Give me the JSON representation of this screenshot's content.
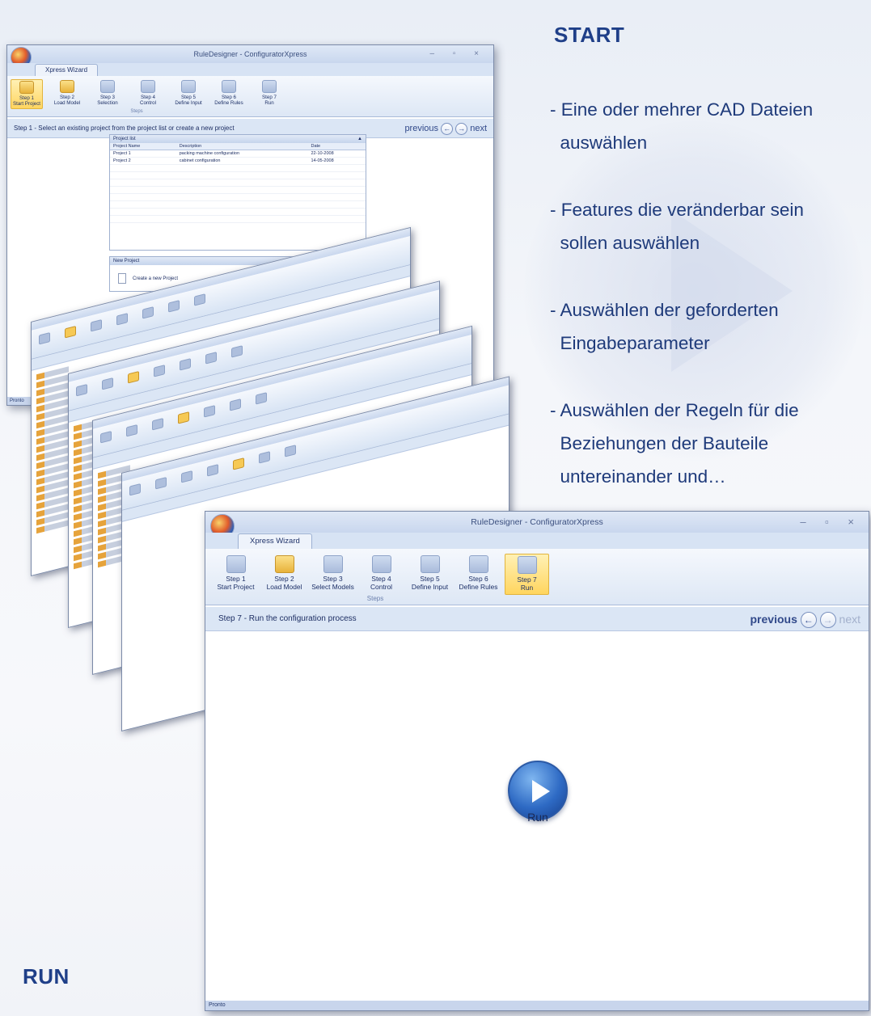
{
  "colors": {
    "heading": "#1f3f88",
    "body_text": "#1e3a7a",
    "ribbon_selected": "#ffd55f"
  },
  "headings": {
    "start": "START",
    "run": "RUN"
  },
  "bullets": [
    {
      "lines": [
        "- Eine oder mehrer CAD Dateien",
        "  auswählen"
      ]
    },
    {
      "lines": [
        "- Features die veränderbar sein",
        "  sollen auswählen"
      ]
    },
    {
      "lines": [
        "- Auswählen der geforderten",
        "  Eingabeparameter"
      ]
    },
    {
      "lines": [
        "- Auswählen der Regeln für die",
        "  Beziehungen der Bauteile",
        "  untereinander und…"
      ]
    }
  ],
  "window1": {
    "title": "RuleDesigner - ConfiguratorXpress",
    "tab": "Xpress Wizard",
    "steps": [
      {
        "line1": "Step 1",
        "line2": "Start Project",
        "selected": true,
        "icon": "project-icon"
      },
      {
        "line1": "Step 2",
        "line2": "Load Model",
        "selected": false,
        "icon": "load-model-icon"
      },
      {
        "line1": "Step 3",
        "line2": "Selection",
        "selected": false,
        "icon": "selection-icon"
      },
      {
        "line1": "Step 4",
        "line2": "Control",
        "selected": false,
        "icon": "control-icon"
      },
      {
        "line1": "Step 5",
        "line2": "Define Input",
        "selected": false,
        "icon": "input-icon"
      },
      {
        "line1": "Step 6",
        "line2": "Define Rules",
        "selected": false,
        "icon": "rules-icon"
      },
      {
        "line1": "Step 7",
        "line2": "Run",
        "selected": false,
        "icon": "run-icon"
      }
    ],
    "group_label": "Steps",
    "step_text": "Step 1 - Select an existing project from the project list or create a new project",
    "nav": {
      "previous": "previous",
      "next": "next"
    },
    "project_list": {
      "title": "Project list",
      "columns": [
        "Project Name",
        "Description",
        "Date"
      ],
      "rows": [
        [
          "Project 1",
          "packing machine configuration",
          "22-10-2008"
        ],
        [
          "Project 2",
          "cabinet configuration",
          "14-05-2008"
        ]
      ]
    },
    "new_project": {
      "title": "New Project",
      "action": "Create a new Project"
    },
    "status": "Pronto"
  },
  "window2": {
    "title": "RuleDesigner - ConfiguratorXpress",
    "tab": "Xpress Wizard",
    "steps": [
      {
        "line1": "Step 1",
        "line2": "Start Project",
        "selected": false,
        "icon": "project-icon"
      },
      {
        "line1": "Step 2",
        "line2": "Load Model",
        "selected": false,
        "icon": "load-model-icon"
      },
      {
        "line1": "Step 3",
        "line2": "Select Models",
        "selected": false,
        "icon": "selection-icon"
      },
      {
        "line1": "Step 4",
        "line2": "Control",
        "selected": false,
        "icon": "control-icon"
      },
      {
        "line1": "Step 5",
        "line2": "Define Input",
        "selected": false,
        "icon": "input-icon"
      },
      {
        "line1": "Step 6",
        "line2": "Define Rules",
        "selected": false,
        "icon": "rules-icon"
      },
      {
        "line1": "Step 7",
        "line2": "Run",
        "selected": true,
        "icon": "run-icon"
      }
    ],
    "group_label": "Steps",
    "step_text": "Step 7 -  Run the configuration process",
    "nav": {
      "previous": "previous",
      "next": "next"
    },
    "run_label": "Run",
    "status": "Pronto"
  }
}
